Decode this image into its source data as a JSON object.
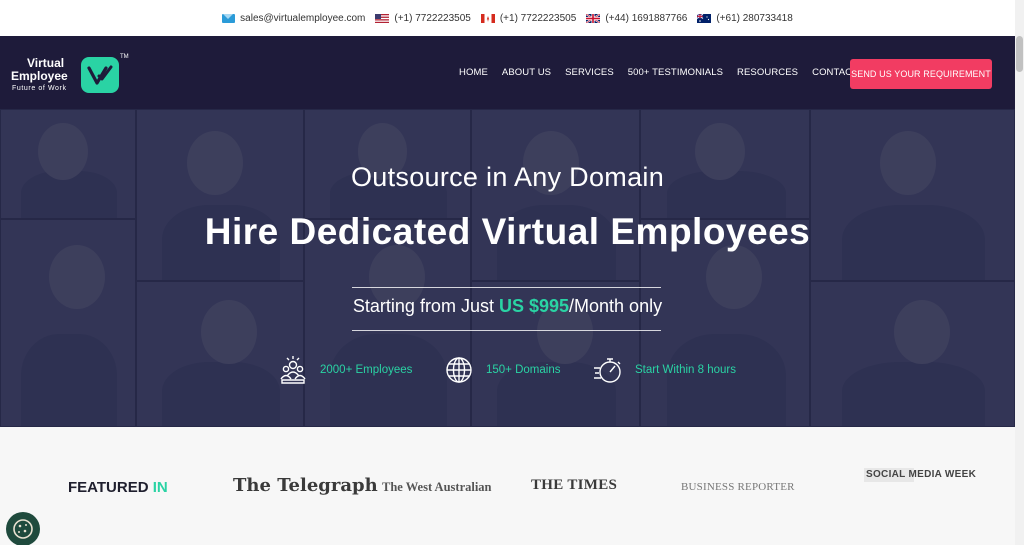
{
  "topbar": {
    "email": "sales@virtualemployee.com",
    "phones": [
      {
        "flag": "US",
        "number": "(+1) 7722223505"
      },
      {
        "flag": "CA",
        "number": "(+1) 7722223505"
      },
      {
        "flag": "UK",
        "number": "(+44) 1691887766"
      },
      {
        "flag": "AU",
        "number": "(+61) 280733418"
      }
    ]
  },
  "logo": {
    "line1": "Virtual",
    "line2": "Employee",
    "tagline": "Future of Work",
    "tm": "TM"
  },
  "nav": {
    "items": [
      "HOME",
      "ABOUT US",
      "SERVICES",
      "500+ TESTIMONIALS",
      "RESOURCES",
      "CONTACT US"
    ],
    "cta": "SEND US YOUR REQUIREMENT"
  },
  "hero": {
    "subtitle": "Outsource in Any Domain",
    "title": "Hire Dedicated Virtual Employees",
    "price_prefix": "Starting from Just ",
    "price_amount": "US $995",
    "price_suffix": "/Month only",
    "stats": [
      "2000+ Employees",
      "150+ Domains",
      "Start Within 8 hours"
    ]
  },
  "featured": {
    "label_main": "FEATURED ",
    "label_accent": "IN",
    "publications": [
      "The Telegraph",
      "The West Australian",
      "THE TIMES",
      "BUSINESS REPORTER",
      "SOCIAL MEDIA WEEK"
    ]
  },
  "colors": {
    "accent": "#2ad3a4",
    "nav_bg": "#1e1b3a",
    "cta": "#f23c62"
  },
  "icons": [
    "mail-icon",
    "team-icon",
    "globe-icon",
    "stopwatch-icon",
    "cookie-icon"
  ]
}
